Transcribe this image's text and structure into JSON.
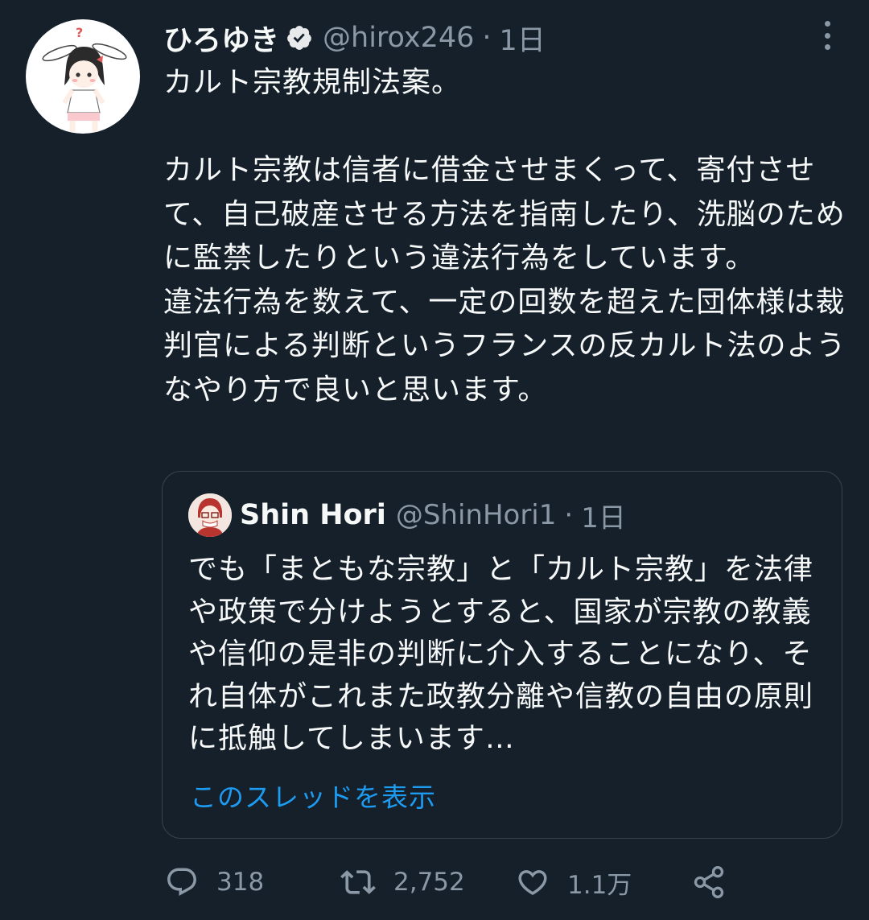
{
  "tweet": {
    "author": {
      "name": "ひろゆき",
      "handle": "@hirox246",
      "verified": true
    },
    "separator": "·",
    "time": "1日",
    "text": "カルト宗教規制法案。\n\nカルト宗教は信者に借金させまくって、寄付させて、自己破産させる方法を指南したり、洗脳のために監禁したりという違法行為をしています。\n違法行為を数えて、一定の回数を超えた団体様は裁判官による判断というフランスの反カルト法のようなやり方で良いと思います。"
  },
  "quote": {
    "author": {
      "name": "Shin Hori",
      "handle": "@ShinHori1"
    },
    "separator": "·",
    "time": "1日",
    "text": "でも「まともな宗教」と「カルト宗教」を法律や政策で分けようとすると、国家が宗教の教義や信仰の是非の判断に介入することになり、それ自体がこれまた政教分離や信教の自由の原則に抵触してしまいます…",
    "show_thread": "このスレッドを表示"
  },
  "actions": {
    "reply": {
      "icon": "reply-icon",
      "count": "318"
    },
    "retweet": {
      "icon": "retweet-icon",
      "count": "2,752"
    },
    "like": {
      "icon": "heart-icon",
      "count": "1.1万"
    },
    "share": {
      "icon": "share-icon"
    }
  },
  "colors": {
    "background": "#15202b",
    "text": "#f7f9f9",
    "secondary": "#8b98a5",
    "border": "#38444d",
    "link": "#1d9bf0"
  }
}
